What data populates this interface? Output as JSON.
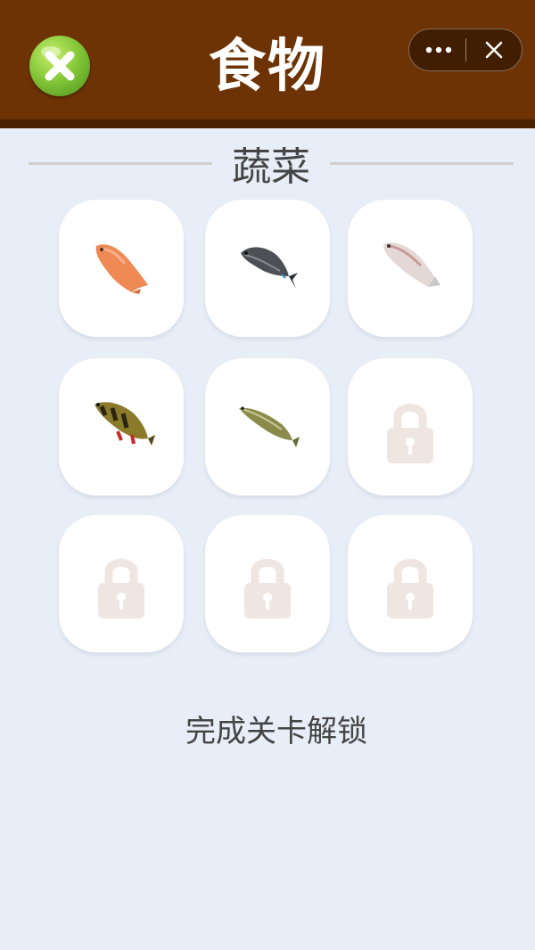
{
  "header": {
    "title": "食物",
    "close_icon": "close-green-icon",
    "capsule": {
      "more_icon": "more-dots-icon",
      "close_icon": "close-icon"
    },
    "bg_color": "#6d3304"
  },
  "section": {
    "title": "蔬菜"
  },
  "grid": {
    "items": [
      {
        "state": "unlocked",
        "icon": "red-snapper-fish-icon"
      },
      {
        "state": "unlocked",
        "icon": "dark-grey-fish-icon"
      },
      {
        "state": "unlocked",
        "icon": "white-fish-icon"
      },
      {
        "state": "unlocked",
        "icon": "peacock-bass-fish-icon"
      },
      {
        "state": "unlocked",
        "icon": "pike-fish-icon"
      },
      {
        "state": "locked",
        "icon": "lock-icon"
      },
      {
        "state": "locked",
        "icon": "lock-icon"
      },
      {
        "state": "locked",
        "icon": "lock-icon"
      },
      {
        "state": "locked",
        "icon": "lock-icon"
      }
    ]
  },
  "footer": {
    "text": "完成关卡解锁"
  }
}
